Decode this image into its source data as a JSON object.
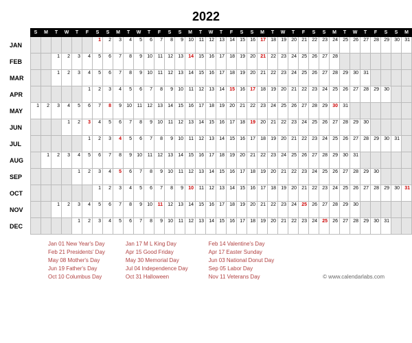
{
  "year": "2022",
  "dow_labels": [
    "S",
    "M",
    "T",
    "W",
    "T",
    "F",
    "S"
  ],
  "columns": 37,
  "months": [
    {
      "name": "JAN",
      "start": 6,
      "days": 31,
      "holidays": [
        1,
        17
      ]
    },
    {
      "name": "FEB",
      "start": 2,
      "days": 28,
      "holidays": [
        14,
        21
      ]
    },
    {
      "name": "MAR",
      "start": 2,
      "days": 31,
      "holidays": []
    },
    {
      "name": "APR",
      "start": 5,
      "days": 30,
      "holidays": [
        15,
        17
      ]
    },
    {
      "name": "MAY",
      "start": 0,
      "days": 31,
      "holidays": [
        8,
        30
      ]
    },
    {
      "name": "JUN",
      "start": 3,
      "days": 30,
      "holidays": [
        3,
        19
      ]
    },
    {
      "name": "JUL",
      "start": 5,
      "days": 31,
      "holidays": [
        4
      ]
    },
    {
      "name": "AUG",
      "start": 1,
      "days": 31,
      "holidays": []
    },
    {
      "name": "SEP",
      "start": 4,
      "days": 30,
      "holidays": [
        5
      ]
    },
    {
      "name": "OCT",
      "start": 6,
      "days": 31,
      "holidays": [
        10,
        31
      ]
    },
    {
      "name": "NOV",
      "start": 2,
      "days": 30,
      "holidays": [
        11,
        25
      ]
    },
    {
      "name": "DEC",
      "start": 4,
      "days": 31,
      "holidays": [
        25
      ]
    }
  ],
  "holiday_list": {
    "col1": [
      "Jan 01  New Year's Day",
      "Feb 21  Presidents' Day",
      "May 08  Mother's Day",
      "Jun 19  Father's Day",
      "Oct 10  Columbus Day"
    ],
    "col2": [
      "Jan 17  M L King Day",
      "Apr 15  Good Friday",
      "May 30  Memorial Day",
      "Jul 04   Independence Day",
      "Oct 31   Halloween"
    ],
    "col3": [
      "Feb 14  Valentine's Day",
      "Apr 17  Easter Sunday",
      "Jun 03  National Donut Day",
      "Sep 05  Labor Day",
      "Nov 11   Veterans Day"
    ]
  },
  "credit": "© www.calendarlabs.com"
}
